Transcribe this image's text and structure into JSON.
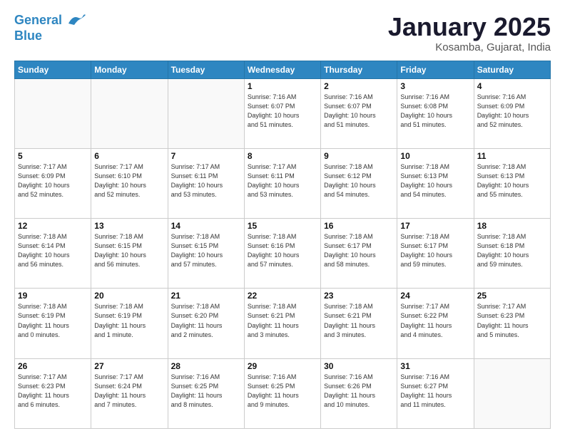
{
  "header": {
    "logo_line1": "General",
    "logo_line2": "Blue",
    "month": "January 2025",
    "location": "Kosamba, Gujarat, India"
  },
  "weekdays": [
    "Sunday",
    "Monday",
    "Tuesday",
    "Wednesday",
    "Thursday",
    "Friday",
    "Saturday"
  ],
  "rows": [
    [
      {
        "day": "",
        "info": ""
      },
      {
        "day": "",
        "info": ""
      },
      {
        "day": "",
        "info": ""
      },
      {
        "day": "1",
        "info": "Sunrise: 7:16 AM\nSunset: 6:07 PM\nDaylight: 10 hours\nand 51 minutes."
      },
      {
        "day": "2",
        "info": "Sunrise: 7:16 AM\nSunset: 6:07 PM\nDaylight: 10 hours\nand 51 minutes."
      },
      {
        "day": "3",
        "info": "Sunrise: 7:16 AM\nSunset: 6:08 PM\nDaylight: 10 hours\nand 51 minutes."
      },
      {
        "day": "4",
        "info": "Sunrise: 7:16 AM\nSunset: 6:09 PM\nDaylight: 10 hours\nand 52 minutes."
      }
    ],
    [
      {
        "day": "5",
        "info": "Sunrise: 7:17 AM\nSunset: 6:09 PM\nDaylight: 10 hours\nand 52 minutes."
      },
      {
        "day": "6",
        "info": "Sunrise: 7:17 AM\nSunset: 6:10 PM\nDaylight: 10 hours\nand 52 minutes."
      },
      {
        "day": "7",
        "info": "Sunrise: 7:17 AM\nSunset: 6:11 PM\nDaylight: 10 hours\nand 53 minutes."
      },
      {
        "day": "8",
        "info": "Sunrise: 7:17 AM\nSunset: 6:11 PM\nDaylight: 10 hours\nand 53 minutes."
      },
      {
        "day": "9",
        "info": "Sunrise: 7:18 AM\nSunset: 6:12 PM\nDaylight: 10 hours\nand 54 minutes."
      },
      {
        "day": "10",
        "info": "Sunrise: 7:18 AM\nSunset: 6:13 PM\nDaylight: 10 hours\nand 54 minutes."
      },
      {
        "day": "11",
        "info": "Sunrise: 7:18 AM\nSunset: 6:13 PM\nDaylight: 10 hours\nand 55 minutes."
      }
    ],
    [
      {
        "day": "12",
        "info": "Sunrise: 7:18 AM\nSunset: 6:14 PM\nDaylight: 10 hours\nand 56 minutes."
      },
      {
        "day": "13",
        "info": "Sunrise: 7:18 AM\nSunset: 6:15 PM\nDaylight: 10 hours\nand 56 minutes."
      },
      {
        "day": "14",
        "info": "Sunrise: 7:18 AM\nSunset: 6:15 PM\nDaylight: 10 hours\nand 57 minutes."
      },
      {
        "day": "15",
        "info": "Sunrise: 7:18 AM\nSunset: 6:16 PM\nDaylight: 10 hours\nand 57 minutes."
      },
      {
        "day": "16",
        "info": "Sunrise: 7:18 AM\nSunset: 6:17 PM\nDaylight: 10 hours\nand 58 minutes."
      },
      {
        "day": "17",
        "info": "Sunrise: 7:18 AM\nSunset: 6:17 PM\nDaylight: 10 hours\nand 59 minutes."
      },
      {
        "day": "18",
        "info": "Sunrise: 7:18 AM\nSunset: 6:18 PM\nDaylight: 10 hours\nand 59 minutes."
      }
    ],
    [
      {
        "day": "19",
        "info": "Sunrise: 7:18 AM\nSunset: 6:19 PM\nDaylight: 11 hours\nand 0 minutes."
      },
      {
        "day": "20",
        "info": "Sunrise: 7:18 AM\nSunset: 6:19 PM\nDaylight: 11 hours\nand 1 minute."
      },
      {
        "day": "21",
        "info": "Sunrise: 7:18 AM\nSunset: 6:20 PM\nDaylight: 11 hours\nand 2 minutes."
      },
      {
        "day": "22",
        "info": "Sunrise: 7:18 AM\nSunset: 6:21 PM\nDaylight: 11 hours\nand 3 minutes."
      },
      {
        "day": "23",
        "info": "Sunrise: 7:18 AM\nSunset: 6:21 PM\nDaylight: 11 hours\nand 3 minutes."
      },
      {
        "day": "24",
        "info": "Sunrise: 7:17 AM\nSunset: 6:22 PM\nDaylight: 11 hours\nand 4 minutes."
      },
      {
        "day": "25",
        "info": "Sunrise: 7:17 AM\nSunset: 6:23 PM\nDaylight: 11 hours\nand 5 minutes."
      }
    ],
    [
      {
        "day": "26",
        "info": "Sunrise: 7:17 AM\nSunset: 6:23 PM\nDaylight: 11 hours\nand 6 minutes."
      },
      {
        "day": "27",
        "info": "Sunrise: 7:17 AM\nSunset: 6:24 PM\nDaylight: 11 hours\nand 7 minutes."
      },
      {
        "day": "28",
        "info": "Sunrise: 7:16 AM\nSunset: 6:25 PM\nDaylight: 11 hours\nand 8 minutes."
      },
      {
        "day": "29",
        "info": "Sunrise: 7:16 AM\nSunset: 6:25 PM\nDaylight: 11 hours\nand 9 minutes."
      },
      {
        "day": "30",
        "info": "Sunrise: 7:16 AM\nSunset: 6:26 PM\nDaylight: 11 hours\nand 10 minutes."
      },
      {
        "day": "31",
        "info": "Sunrise: 7:16 AM\nSunset: 6:27 PM\nDaylight: 11 hours\nand 11 minutes."
      },
      {
        "day": "",
        "info": ""
      }
    ]
  ]
}
